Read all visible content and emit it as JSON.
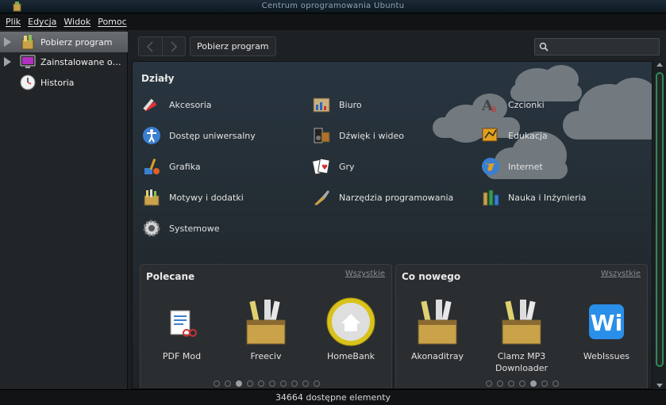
{
  "window": {
    "title": "Centrum oprogramowania Ubuntu"
  },
  "menu": [
    {
      "label": "Plik"
    },
    {
      "label": "Edycja"
    },
    {
      "label": "Widok"
    },
    {
      "label": "Pomoc"
    }
  ],
  "sidebar": {
    "items": [
      {
        "label": "Pobierz program",
        "icon": "software-center-icon",
        "active": true
      },
      {
        "label": "Zainstalowane oprogramowanie",
        "icon": "monitor-icon",
        "active": false
      },
      {
        "label": "Historia",
        "icon": "clock-icon",
        "active": false
      }
    ]
  },
  "toolbar": {
    "back_icon": "back-arrow-icon",
    "forward_icon": "forward-arrow-icon",
    "breadcrumb": "Pobierz program",
    "search_placeholder": ""
  },
  "departments": {
    "title": "Działy",
    "items": [
      {
        "label": "Akcesoria",
        "icon": "accessories-icon"
      },
      {
        "label": "Biuro",
        "icon": "office-icon"
      },
      {
        "label": "Czcionki",
        "icon": "fonts-icon"
      },
      {
        "label": "Dostęp uniwersalny",
        "icon": "accessibility-icon"
      },
      {
        "label": "Dźwięk i wideo",
        "icon": "sound-video-icon"
      },
      {
        "label": "Edukacja",
        "icon": "education-icon"
      },
      {
        "label": "Grafika",
        "icon": "graphics-icon"
      },
      {
        "label": "Gry",
        "icon": "games-icon"
      },
      {
        "label": "Internet",
        "icon": "internet-icon"
      },
      {
        "label": "Motywy i dodatki",
        "icon": "themes-icon"
      },
      {
        "label": "Narzędzia programowania",
        "icon": "developer-tools-icon"
      },
      {
        "label": "Nauka i Inżynieria",
        "icon": "science-icon"
      },
      {
        "label": "Systemowe",
        "icon": "system-gear-icon"
      }
    ]
  },
  "featured": {
    "title": "Polecane",
    "see_all": "Wszystkie",
    "apps": [
      {
        "label": "PDF Mod",
        "icon": "pdf-mod-icon"
      },
      {
        "label": "Freeciv",
        "icon": "package-box-icon"
      },
      {
        "label": "HomeBank",
        "icon": "homebank-icon"
      }
    ],
    "pages": 10,
    "current_page": 3
  },
  "whats_new": {
    "title": "Co nowego",
    "see_all": "Wszystkie",
    "apps": [
      {
        "label": "Akonaditray",
        "icon": "package-box-icon"
      },
      {
        "label": "Clamz MP3 Downloader",
        "icon": "package-box-icon"
      },
      {
        "label": "WebIssues",
        "icon": "webissues-icon"
      }
    ],
    "pages": 7,
    "current_page": 5
  },
  "status": {
    "text": "34664 dostępne elementy"
  },
  "colors": {
    "accent_green": "#2f8a55",
    "background": "#232b31",
    "sidebar_active": "#5f6367"
  }
}
